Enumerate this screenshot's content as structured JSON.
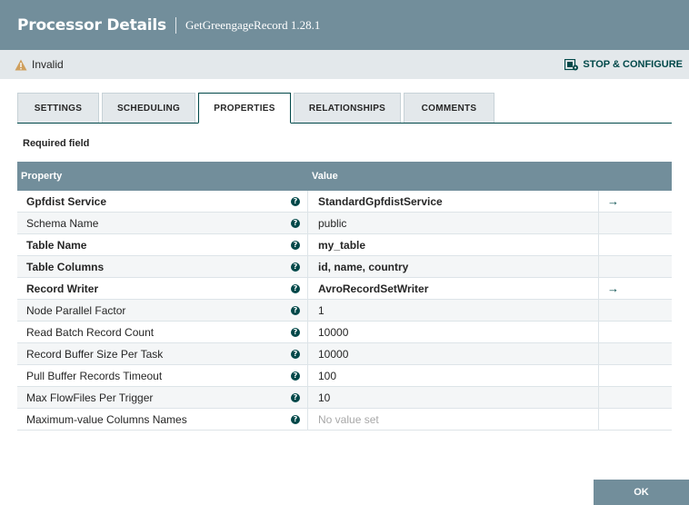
{
  "header": {
    "title": "Processor Details",
    "subtitle": "GetGreengageRecord 1.28.1"
  },
  "status": {
    "label": "Invalid",
    "icon": "warning-icon",
    "icon_color": "#cf9f5d",
    "stop_configure_label": "STOP & CONFIGURE"
  },
  "tabs": [
    {
      "label": "SETTINGS",
      "active": false
    },
    {
      "label": "SCHEDULING",
      "active": false
    },
    {
      "label": "PROPERTIES",
      "active": true
    },
    {
      "label": "RELATIONSHIPS",
      "active": false
    },
    {
      "label": "COMMENTS",
      "active": false
    }
  ],
  "required_field_label": "Required field",
  "table": {
    "headers": {
      "property": "Property",
      "value": "Value"
    },
    "rows": [
      {
        "name": "Gpfdist Service",
        "value": "StandardGpfdistService",
        "required": true,
        "goto": true,
        "unset": false
      },
      {
        "name": "Schema Name",
        "value": "public",
        "required": false,
        "goto": false,
        "unset": false
      },
      {
        "name": "Table Name",
        "value": "my_table",
        "required": true,
        "goto": false,
        "unset": false
      },
      {
        "name": "Table Columns",
        "value": "id, name, country",
        "required": true,
        "goto": false,
        "unset": false
      },
      {
        "name": "Record Writer",
        "value": "AvroRecordSetWriter",
        "required": true,
        "goto": true,
        "unset": false
      },
      {
        "name": "Node Parallel Factor",
        "value": "1",
        "required": false,
        "goto": false,
        "unset": false
      },
      {
        "name": "Read Batch Record Count",
        "value": "10000",
        "required": false,
        "goto": false,
        "unset": false
      },
      {
        "name": "Record Buffer Size Per Task",
        "value": "10000",
        "required": false,
        "goto": false,
        "unset": false
      },
      {
        "name": "Pull Buffer Records Timeout",
        "value": "100",
        "required": false,
        "goto": false,
        "unset": false
      },
      {
        "name": "Max FlowFiles Per Trigger",
        "value": "10",
        "required": false,
        "goto": false,
        "unset": false
      },
      {
        "name": "Maximum-value Columns Names",
        "value": "No value set",
        "required": false,
        "goto": false,
        "unset": true
      }
    ]
  },
  "ok_label": "OK"
}
